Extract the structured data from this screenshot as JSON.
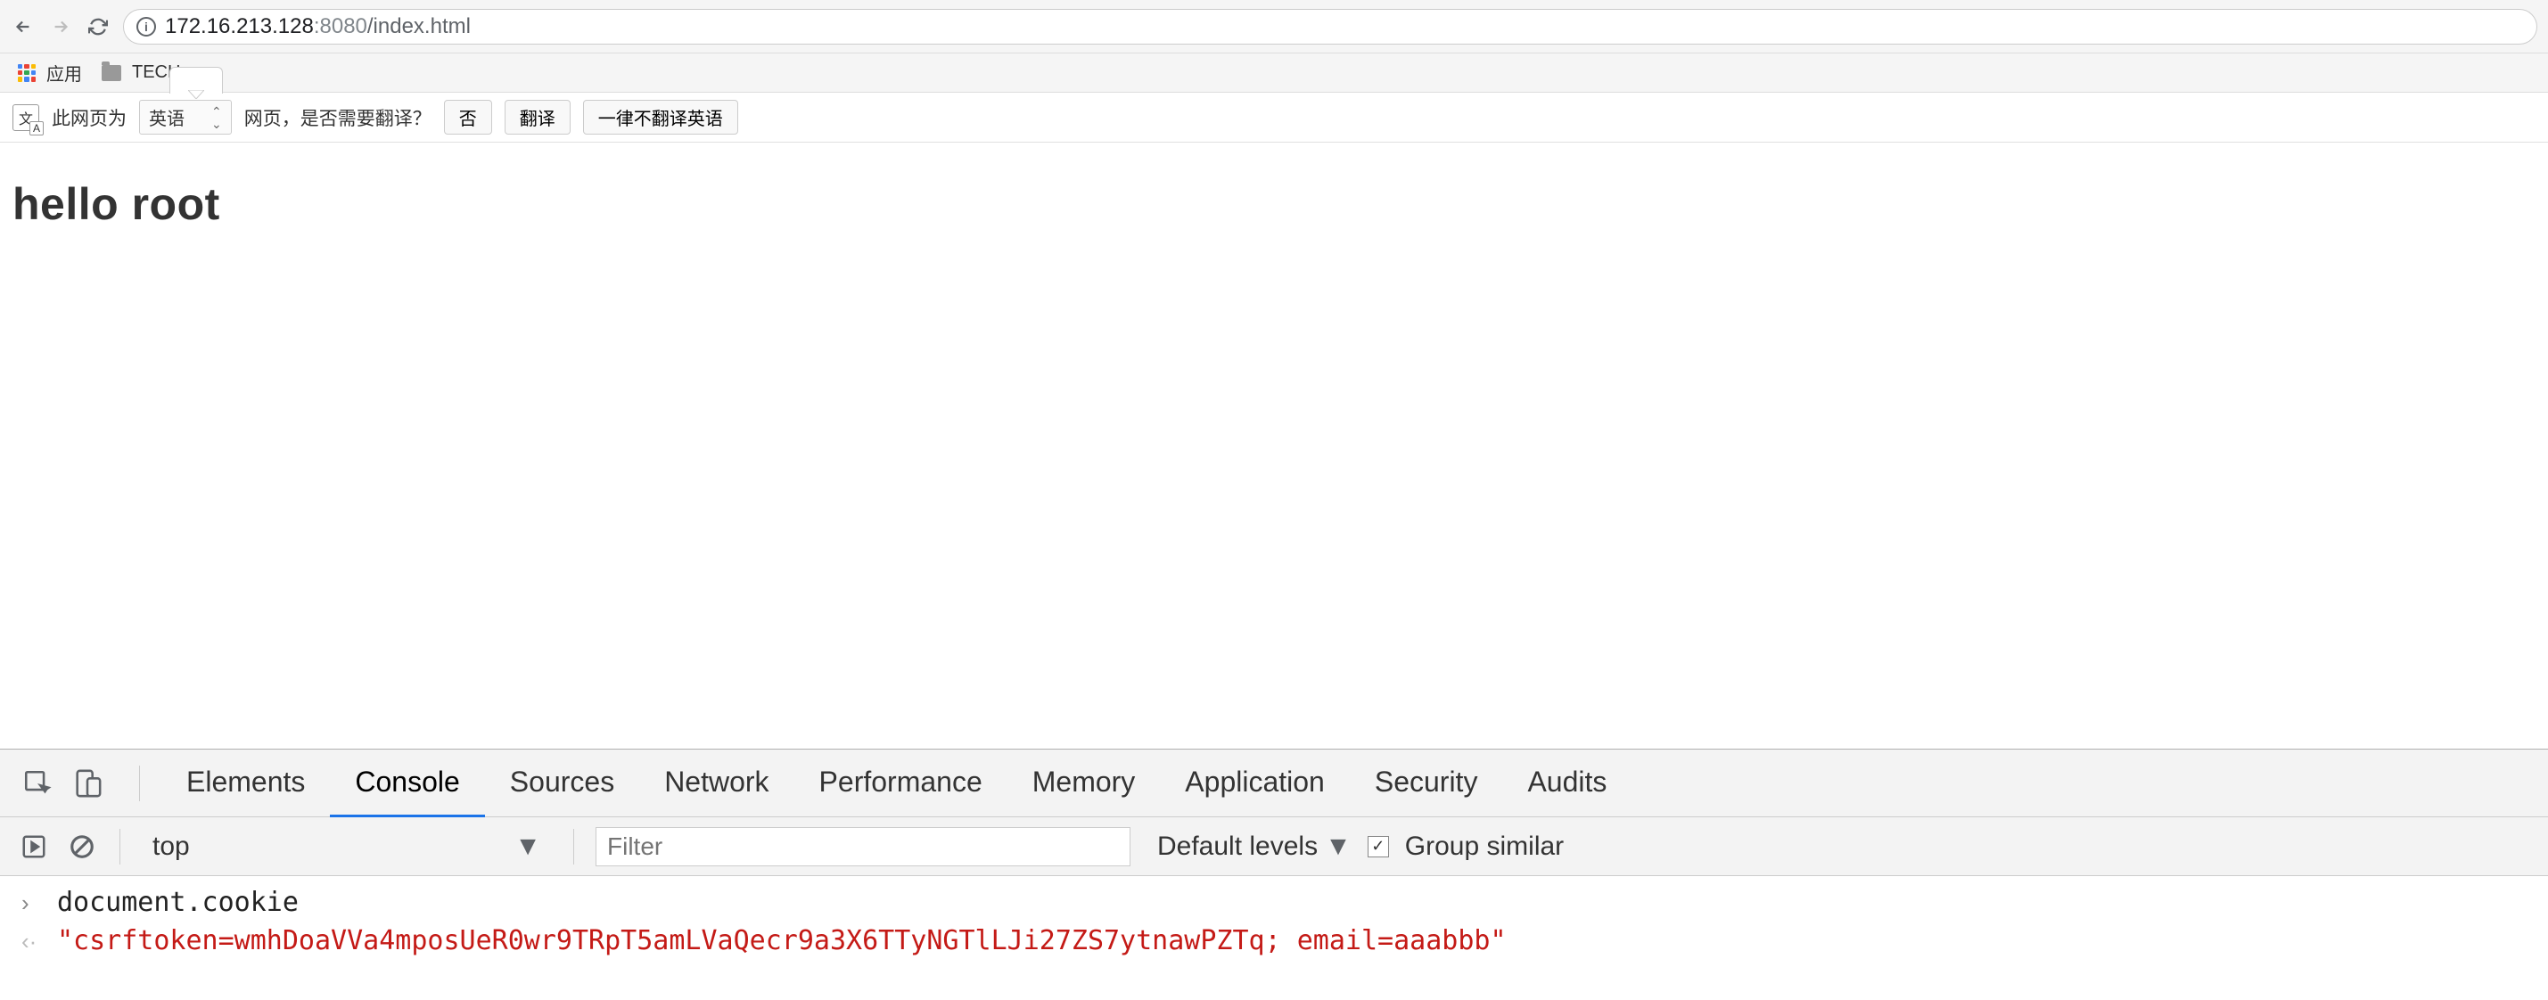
{
  "navbar": {
    "url_host": "172.16.213.128",
    "url_port": ":8080",
    "url_path": "/index.html"
  },
  "bookmarks": {
    "apps_label": "应用",
    "folder_label": "TECH"
  },
  "translate": {
    "prefix": "此网页为",
    "language": "英语",
    "question": "网页，是否需要翻译？",
    "btn_no": "否",
    "btn_translate": "翻译",
    "btn_never": "一律不翻译英语"
  },
  "page": {
    "heading": "hello root"
  },
  "devtools": {
    "tabs": {
      "elements": "Elements",
      "console": "Console",
      "sources": "Sources",
      "network": "Network",
      "performance": "Performance",
      "memory": "Memory",
      "application": "Application",
      "security": "Security",
      "audits": "Audits"
    },
    "toolbar": {
      "context": "top",
      "filter_placeholder": "Filter",
      "levels": "Default levels",
      "group_similar": "Group similar"
    },
    "console": {
      "input": "document.cookie",
      "output": "\"csrftoken=wmhDoaVVa4mposUeR0wr9TRpT5amLVaQecr9a3X6TTyNGTlLJi27ZS7ytnawPZTq; email=aaabbb\""
    }
  }
}
